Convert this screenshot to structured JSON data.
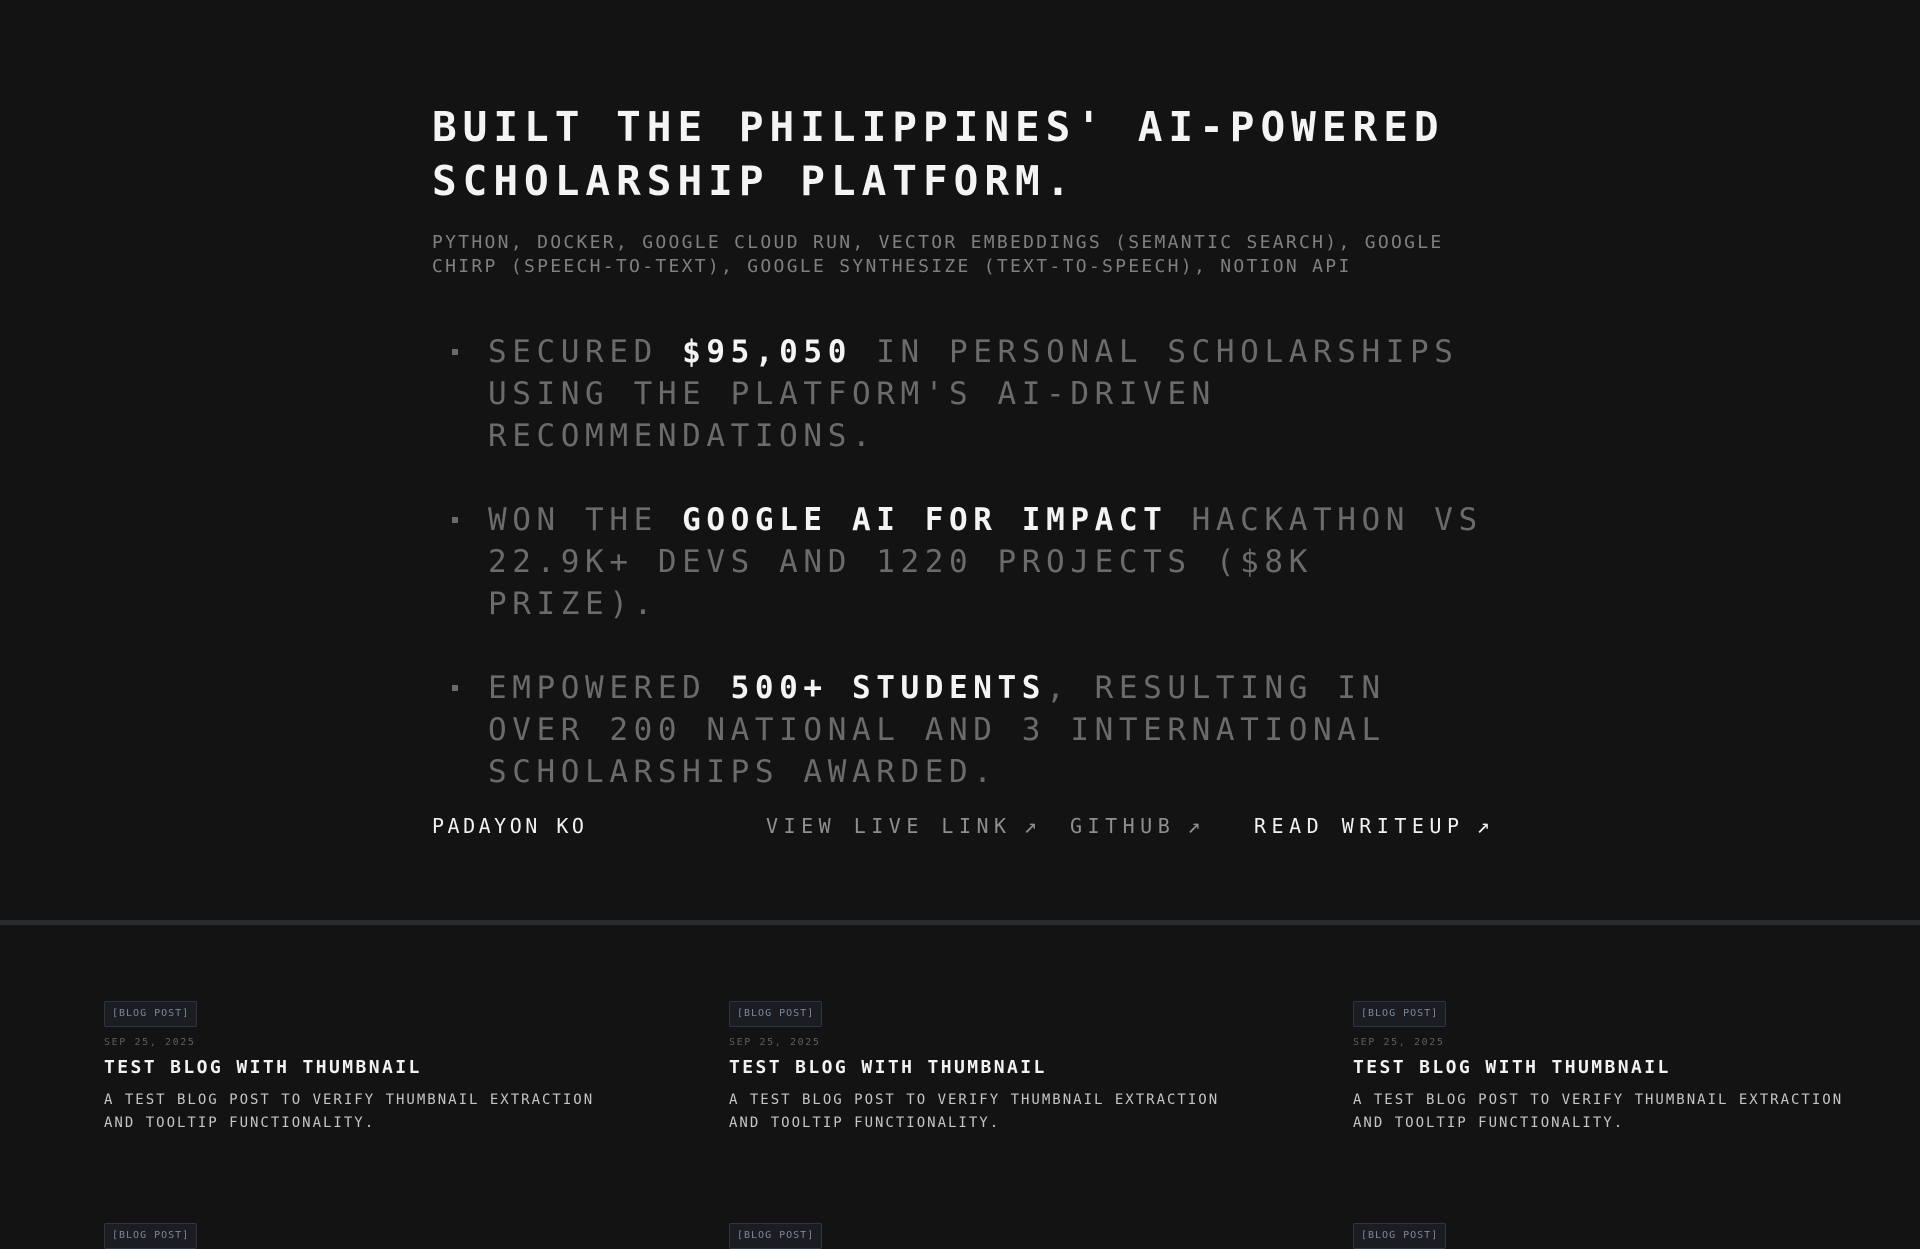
{
  "project": {
    "headline": "Built the Philippines' AI-powered scholarship platform.",
    "stack": "Python, Docker, Google Cloud Run, Vector Embeddings (Semantic Search), Google Chirp (Speech-to-Text), Google Synthesize (Text-to-Speech), Notion API",
    "bullets": [
      {
        "pre": "Secured ",
        "highlight": "$95,050",
        "post": " in personal scholarships using the platform's AI-driven recommendations."
      },
      {
        "pre": "Won the ",
        "highlight": "Google AI for Impact",
        "post": " Hackathon vs 22.9K+ devs and 1220 projects ($8K prize)."
      },
      {
        "pre": "Empowered ",
        "highlight": "500+ students",
        "post": ", resulting in over 200 national and 3 international scholarships awarded."
      }
    ],
    "name": "Padayon Ko",
    "links": {
      "live": "View Live Link",
      "github": "GitHub",
      "writeup": "Read Writeup",
      "arrow": "↗"
    }
  },
  "posts": [
    {
      "badge": "[Blog Post]",
      "date": "Sep 25, 2025",
      "title": "Test Blog with Thumbnail",
      "description": "A test blog post to verify thumbnail extraction and tooltip functionality."
    },
    {
      "badge": "[Blog Post]",
      "date": "Sep 25, 2025",
      "title": "Test Blog with Thumbnail",
      "description": "A test blog post to verify thumbnail extraction and tooltip functionality."
    },
    {
      "badge": "[Blog Post]",
      "date": "Sep 25, 2025",
      "title": "Test Blog with Thumbnail",
      "description": "A test blog post to verify thumbnail extraction and tooltip functionality."
    }
  ],
  "next_row_badges": [
    "[Blog Post]",
    "[Blog Post]",
    "[Blog Post]"
  ]
}
